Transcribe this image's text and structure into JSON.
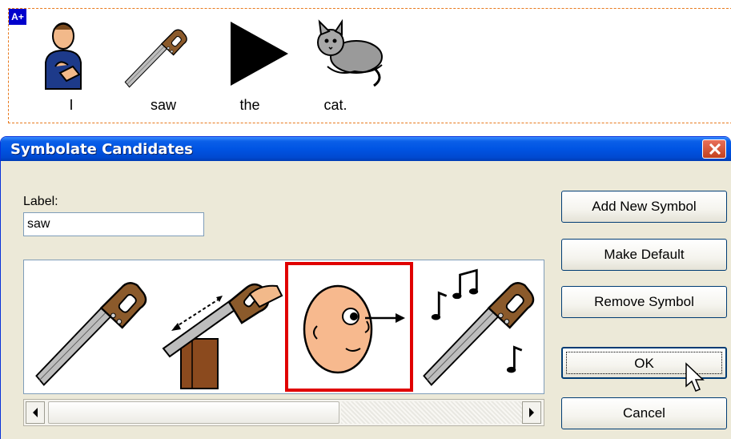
{
  "strip": {
    "badge": "A+",
    "words": [
      "I",
      "saw",
      "the",
      "cat."
    ],
    "symbols": [
      "person-signing-icon",
      "saw-icon",
      "play-triangle-icon",
      "cat-icon"
    ]
  },
  "dialog": {
    "title": "Symbolate Candidates",
    "label_caption": "Label:",
    "label_value": "saw",
    "candidates": [
      "saw-icon",
      "sawing-wood-icon",
      "face-looking-icon",
      "saw-music-icon"
    ],
    "selected_candidate": 2,
    "buttons": {
      "add": "Add New Symbol",
      "default": "Make Default",
      "remove": "Remove Symbol",
      "ok": "OK",
      "cancel": "Cancel"
    }
  },
  "colors": {
    "titlebar": "#0054e3",
    "selection": "#e00000",
    "strip_border": "#e87a1e"
  }
}
